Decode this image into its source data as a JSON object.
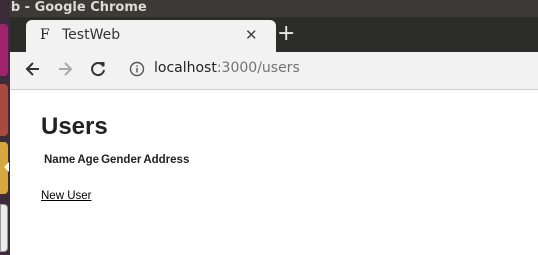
{
  "window": {
    "title": "eb - Google Chrome"
  },
  "tab": {
    "favicon_glyph": "F",
    "title": "TestWeb",
    "close_glyph": "✕",
    "new_tab_glyph": "+"
  },
  "address_bar": {
    "host": "localhost",
    "path": ":3000/users"
  },
  "toolbar": {
    "back_icon": "arrow-left-icon",
    "forward_icon": "arrow-right-icon",
    "reload_icon": "reload-icon",
    "info_icon": "info-icon"
  },
  "page": {
    "heading": "Users",
    "table": {
      "headers": [
        "Name",
        "Age",
        "Gender",
        "Address"
      ]
    },
    "new_user_link": "New User"
  },
  "colors": {
    "title_bar": "#3b3a37",
    "tab_strip": "#2c2c2b",
    "toolbar": "#f2f2f2",
    "launcher": "#3c2b3a"
  }
}
